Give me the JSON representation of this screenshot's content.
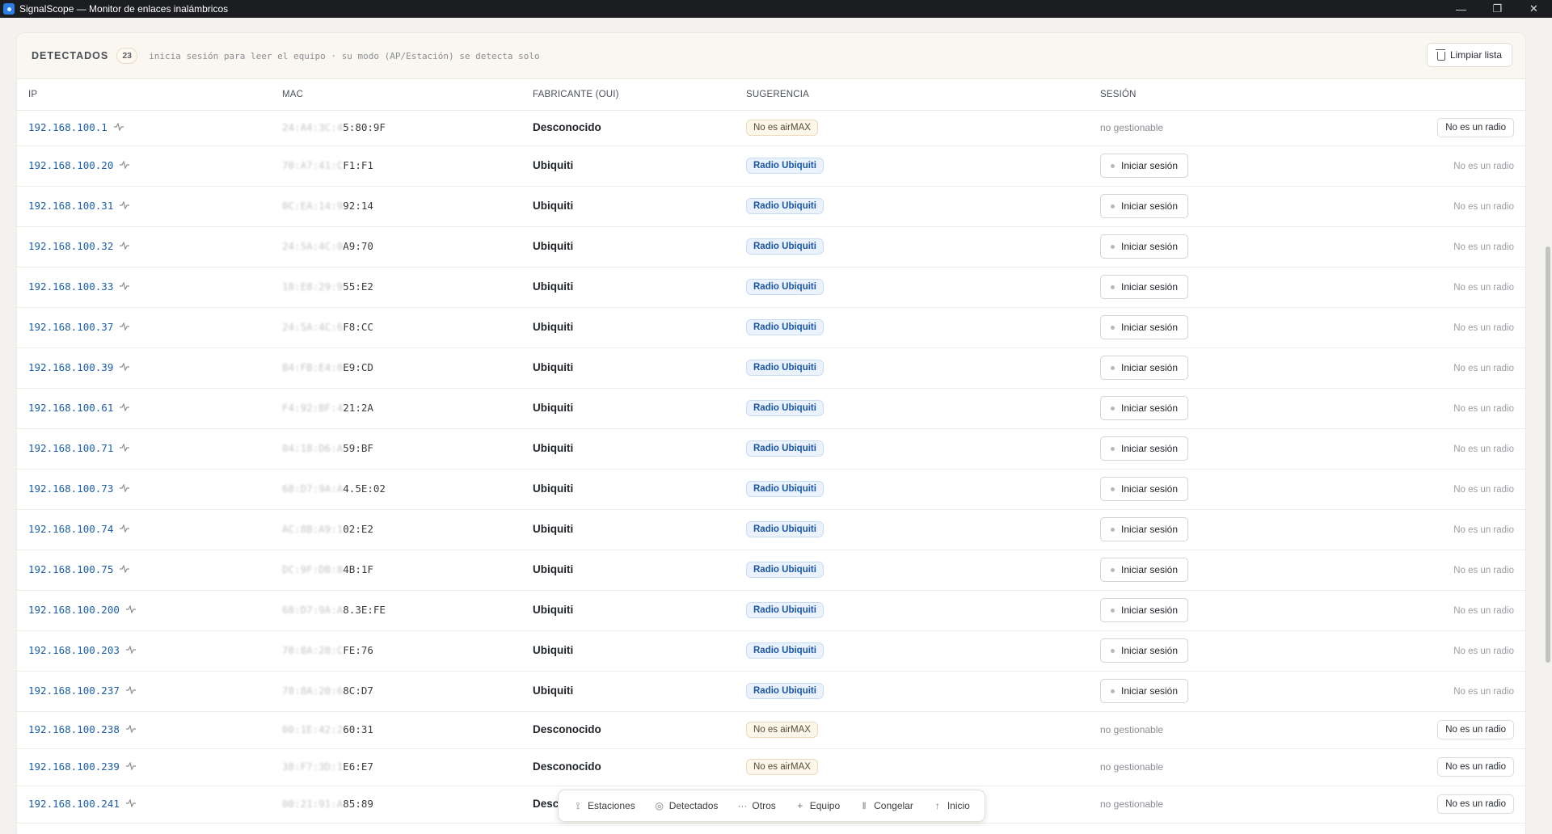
{
  "window": {
    "title": "SignalScope — Monitor de enlaces inalámbricos",
    "controls": [
      "minimize-icon",
      "restore-icon",
      "close-icon"
    ]
  },
  "header": {
    "title": "DETECTADOS",
    "count": "23",
    "hint": "inicia sesión para leer el equipo · su modo (AP/Estación) se detecta solo",
    "clear_label": "Limpiar lista"
  },
  "columns": {
    "ip": "IP",
    "mac": "MAC",
    "vendor": "FABRICANTE (OUI)",
    "suggestion": "SUGERENCIA",
    "session": "SESIÓN"
  },
  "labels": {
    "radio_ubiquiti": "Radio Ubiquiti",
    "no_airmax": "No es airMAX",
    "login": "Iniciar sesión",
    "not_manageable": "no gestionable",
    "not_radio": "No es un radio"
  },
  "rows": [
    {
      "ip": "192.168.100.1",
      "mac_hidden": "24:A4:3C:4",
      "mac_visible": "5:80:9F",
      "vendor": "Desconocido",
      "kind": "other"
    },
    {
      "ip": "192.168.100.20",
      "mac_hidden": "70:A7:41:C",
      "mac_visible": "F1:F1",
      "vendor": "Ubiquiti",
      "kind": "ubnt"
    },
    {
      "ip": "192.168.100.31",
      "mac_hidden": "0C:EA:14:9",
      "mac_visible": "92:14",
      "vendor": "Ubiquiti",
      "kind": "ubnt"
    },
    {
      "ip": "192.168.100.32",
      "mac_hidden": "24:5A:4C:0",
      "mac_visible": "A9:70",
      "vendor": "Ubiquiti",
      "kind": "ubnt"
    },
    {
      "ip": "192.168.100.33",
      "mac_hidden": "18:E8:29:9",
      "mac_visible": "55:E2",
      "vendor": "Ubiquiti",
      "kind": "ubnt"
    },
    {
      "ip": "192.168.100.37",
      "mac_hidden": "24:5A:4C:6",
      "mac_visible": "F8:CC",
      "vendor": "Ubiquiti",
      "kind": "ubnt"
    },
    {
      "ip": "192.168.100.39",
      "mac_hidden": "B4:FB:E4:0",
      "mac_visible": "E9:CD",
      "vendor": "Ubiquiti",
      "kind": "ubnt"
    },
    {
      "ip": "192.168.100.61",
      "mac_hidden": "F4:92:BF:4",
      "mac_visible": "21:2A",
      "vendor": "Ubiquiti",
      "kind": "ubnt"
    },
    {
      "ip": "192.168.100.71",
      "mac_hidden": "04:18:D6:A",
      "mac_visible": "59:BF",
      "vendor": "Ubiquiti",
      "kind": "ubnt"
    },
    {
      "ip": "192.168.100.73",
      "mac_hidden": "68:D7:9A:A",
      "mac_visible": "4.5E:02",
      "vendor": "Ubiquiti",
      "kind": "ubnt"
    },
    {
      "ip": "192.168.100.74",
      "mac_hidden": "AC:8B:A9:1",
      "mac_visible": "02:E2",
      "vendor": "Ubiquiti",
      "kind": "ubnt"
    },
    {
      "ip": "192.168.100.75",
      "mac_hidden": "DC:9F:DB:8",
      "mac_visible": "4B:1F",
      "vendor": "Ubiquiti",
      "kind": "ubnt"
    },
    {
      "ip": "192.168.100.200",
      "mac_hidden": "68:D7:9A:A",
      "mac_visible": "8.3E:FE",
      "vendor": "Ubiquiti",
      "kind": "ubnt"
    },
    {
      "ip": "192.168.100.203",
      "mac_hidden": "78:8A:20:C",
      "mac_visible": "FE:76",
      "vendor": "Ubiquiti",
      "kind": "ubnt"
    },
    {
      "ip": "192.168.100.237",
      "mac_hidden": "78:8A:20:6",
      "mac_visible": "8C:D7",
      "vendor": "Ubiquiti",
      "kind": "ubnt"
    },
    {
      "ip": "192.168.100.238",
      "mac_hidden": "00:1E:42:2",
      "mac_visible": "60:31",
      "vendor": "Desconocido",
      "kind": "other"
    },
    {
      "ip": "192.168.100.239",
      "mac_hidden": "38:F7:3D:1",
      "mac_visible": "E6:E7",
      "vendor": "Desconocido",
      "kind": "other"
    },
    {
      "ip": "192.168.100.241",
      "mac_hidden": "00:21:91:A",
      "mac_visible": "85:89",
      "vendor": "Desconocido",
      "kind": "other"
    }
  ],
  "dock": [
    {
      "icon": "signal-icon",
      "glyph": "⟟",
      "label": "Estaciones"
    },
    {
      "icon": "radar-icon",
      "glyph": "◎",
      "label": "Detectados"
    },
    {
      "icon": "more-icon",
      "glyph": "···",
      "label": "Otros"
    },
    {
      "icon": "plus-icon",
      "glyph": "+",
      "label": "Equipo"
    },
    {
      "icon": "pause-icon",
      "glyph": "ǁ",
      "label": "Congelar"
    },
    {
      "icon": "arrow-up-icon",
      "glyph": "↑",
      "label": "Inicio"
    }
  ],
  "colors": {
    "accent": "#1c5fa8",
    "titlebar": "#1b1d21",
    "badge_ubnt": "#eaf2fd",
    "badge_noair": "#fdf6ea"
  }
}
